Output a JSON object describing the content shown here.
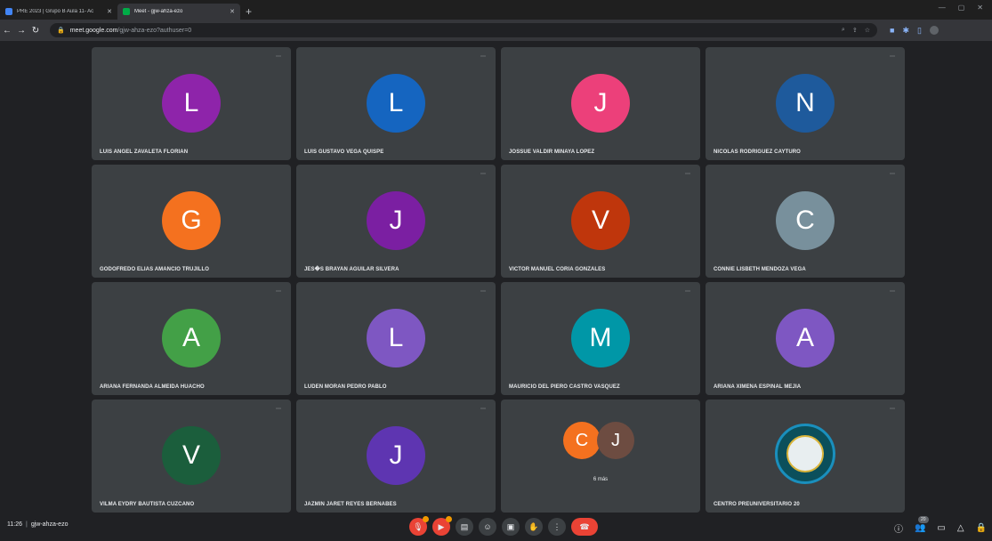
{
  "browser": {
    "tabs": [
      {
        "title": "PRE 2023 | Grupo B Aula 11- Ac",
        "favicon_color": "#4285f4"
      },
      {
        "title": "Meet - gjw-ahza-ezo",
        "favicon_color": "#00ac47"
      }
    ],
    "url_host": "meet.google.com",
    "url_path": "/gjw-ahza-ezo?authuser=0"
  },
  "participants": [
    {
      "initial": "L",
      "name": "LUIS ANGEL ZAVALETA FLORIAN",
      "color": "#8e24aa"
    },
    {
      "initial": "L",
      "name": "LUIS GUSTAVO VEGA QUISPE",
      "color": "#1565c0"
    },
    {
      "initial": "J",
      "name": "JOSSUE VALDIR MINAYA LOPEZ",
      "color": "#ec407a"
    },
    {
      "initial": "N",
      "name": "NICOLAS RODRIGUEZ CAYTURO",
      "color": "#1e5a9c"
    },
    {
      "initial": "G",
      "name": "GODOFREDO ELIAS AMANCIO TRUJILLO",
      "color": "#f4711f"
    },
    {
      "initial": "J",
      "name": "JES�S BRAYAN AGUILAR SILVERA",
      "color": "#7b1fa2"
    },
    {
      "initial": "V",
      "name": "VICTOR MANUEL CORIA GONZALES",
      "color": "#bf360c"
    },
    {
      "initial": "C",
      "name": "CONNIE LISBETH MENDOZA VEGA",
      "color": "#78909c"
    },
    {
      "initial": "A",
      "name": "ARIANA FERNANDA ALMEIDA HUACHO",
      "color": "#43a047"
    },
    {
      "initial": "L",
      "name": "LUDEN MORAN PEDRO PABLO",
      "color": "#7e57c2"
    },
    {
      "initial": "M",
      "name": "MAURICIO DEL PIERO CASTRO VASQUEZ",
      "color": "#0097a7"
    },
    {
      "initial": "A",
      "name": "ARIANA XIMENA ESPINAL MEJIA",
      "color": "#7e57c2"
    },
    {
      "initial": "V",
      "name": "VILMA EYDRY BAUTISTA CUZCANO",
      "color": "#1b5e3c"
    },
    {
      "initial": "J",
      "name": "JAZMIN JARET REYES BERNABES",
      "color": "#5e35b1"
    }
  ],
  "group_tile": {
    "initials": [
      {
        "initial": "C",
        "color": "#f4711f"
      },
      {
        "initial": "J",
        "color": "#6d4c41"
      }
    ],
    "more_label": "6 más"
  },
  "last_tile": {
    "name": "CENTRO PREUNIVERSITARIO 20"
  },
  "bottom": {
    "time": "11:26",
    "meeting_code": "gjw-ahza-ezo",
    "people_count": "20"
  }
}
